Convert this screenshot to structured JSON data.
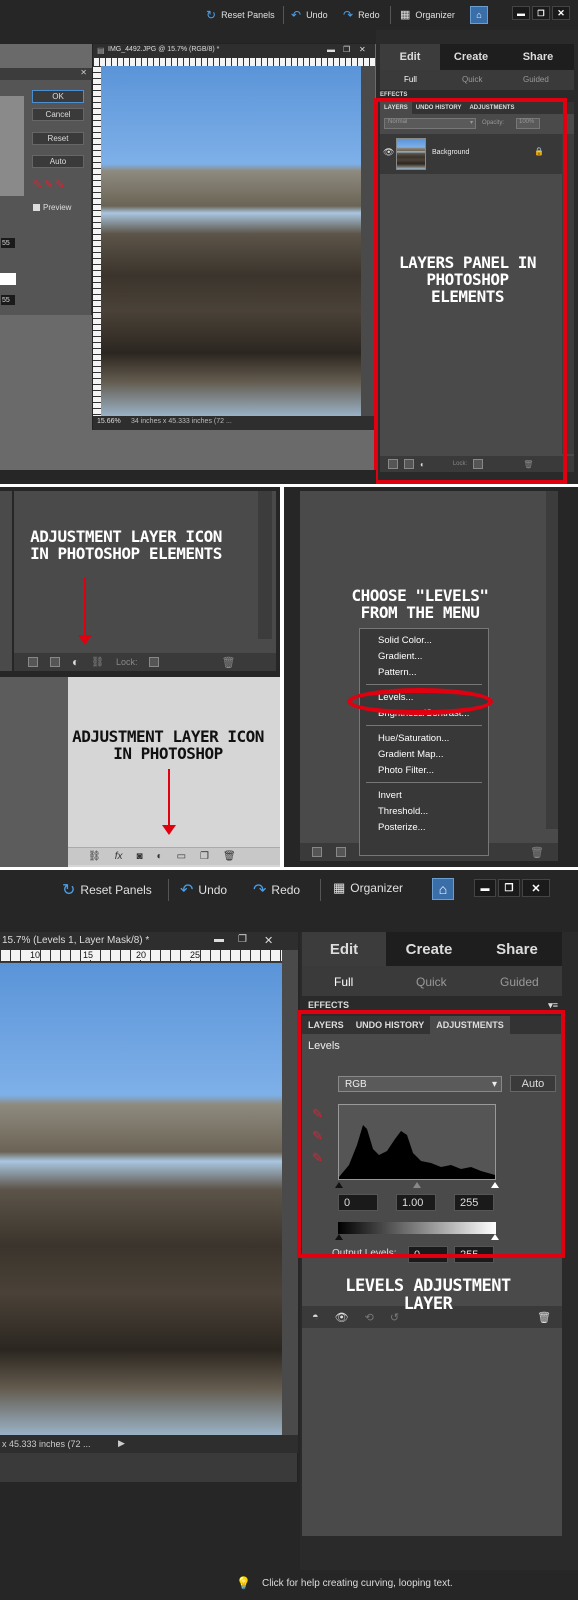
{
  "toolbar": {
    "reset_panels": "Reset Panels",
    "undo": "Undo",
    "redo": "Redo",
    "organizer": "Organizer"
  },
  "panel_tabs": {
    "edit": "Edit",
    "create": "Create",
    "share": "Share"
  },
  "mode_tabs": {
    "full": "Full",
    "quick": "Quick",
    "guided": "Guided"
  },
  "effects_label": "EFFECTS",
  "layers_tabs": {
    "layers": "LAYERS",
    "undo_history": "UNDO HISTORY",
    "adjustments": "ADJUSTMENTS"
  },
  "blend_mode": "Normal",
  "opacity_label": "Opacity:",
  "opacity_value": "100%",
  "layer_name": "Background",
  "lock_label": "Lock:",
  "dialog": {
    "ok": "OK",
    "cancel": "Cancel",
    "reset": "Reset",
    "auto": "Auto",
    "preview": "Preview",
    "val1": "55",
    "val2": "55"
  },
  "doc1": {
    "title": "IMG_4492.JPG @ 15.7% (RGB/8) *",
    "zoom": "15.66%",
    "size": "34 inches x 45.333 inches (72 ..."
  },
  "doc2": {
    "title": "15.7% (Levels 1, Layer Mask/8) *",
    "size": "x 45.333 inches (72 ...",
    "ruler": [
      "10",
      "15",
      "20",
      "25"
    ]
  },
  "annotations": {
    "layers_panel": "Layers panel in Photoshop Elements",
    "adj_icon_pse": "Adjustment layer icon in Photoshop Elements",
    "choose_levels": "Choose \"levels\" from the menu",
    "adj_icon_ps": "Adjustment layer icon in Photoshop",
    "levels_adj": "Levels adjustment layer"
  },
  "menu_items": [
    "Solid Color...",
    "Gradient...",
    "Pattern...",
    "Levels...",
    "Brightness/Contrast...",
    "Hue/Saturation...",
    "Gradient Map...",
    "Photo Filter...",
    "Invert",
    "Threshold...",
    "Posterize..."
  ],
  "levels": {
    "title": "Levels",
    "channel": "RGB",
    "auto": "Auto",
    "input_black": "0",
    "input_gamma": "1.00",
    "input_white": "255",
    "output_label": "Output Levels:",
    "output_black": "0",
    "output_white": "255"
  },
  "status_tip": "Click for help creating curving, looping text.",
  "colors": {
    "highlight": "#e00010",
    "panel": "#4a4a4a",
    "toolbar": "#262626",
    "accent_blue": "#3a8fd8"
  }
}
